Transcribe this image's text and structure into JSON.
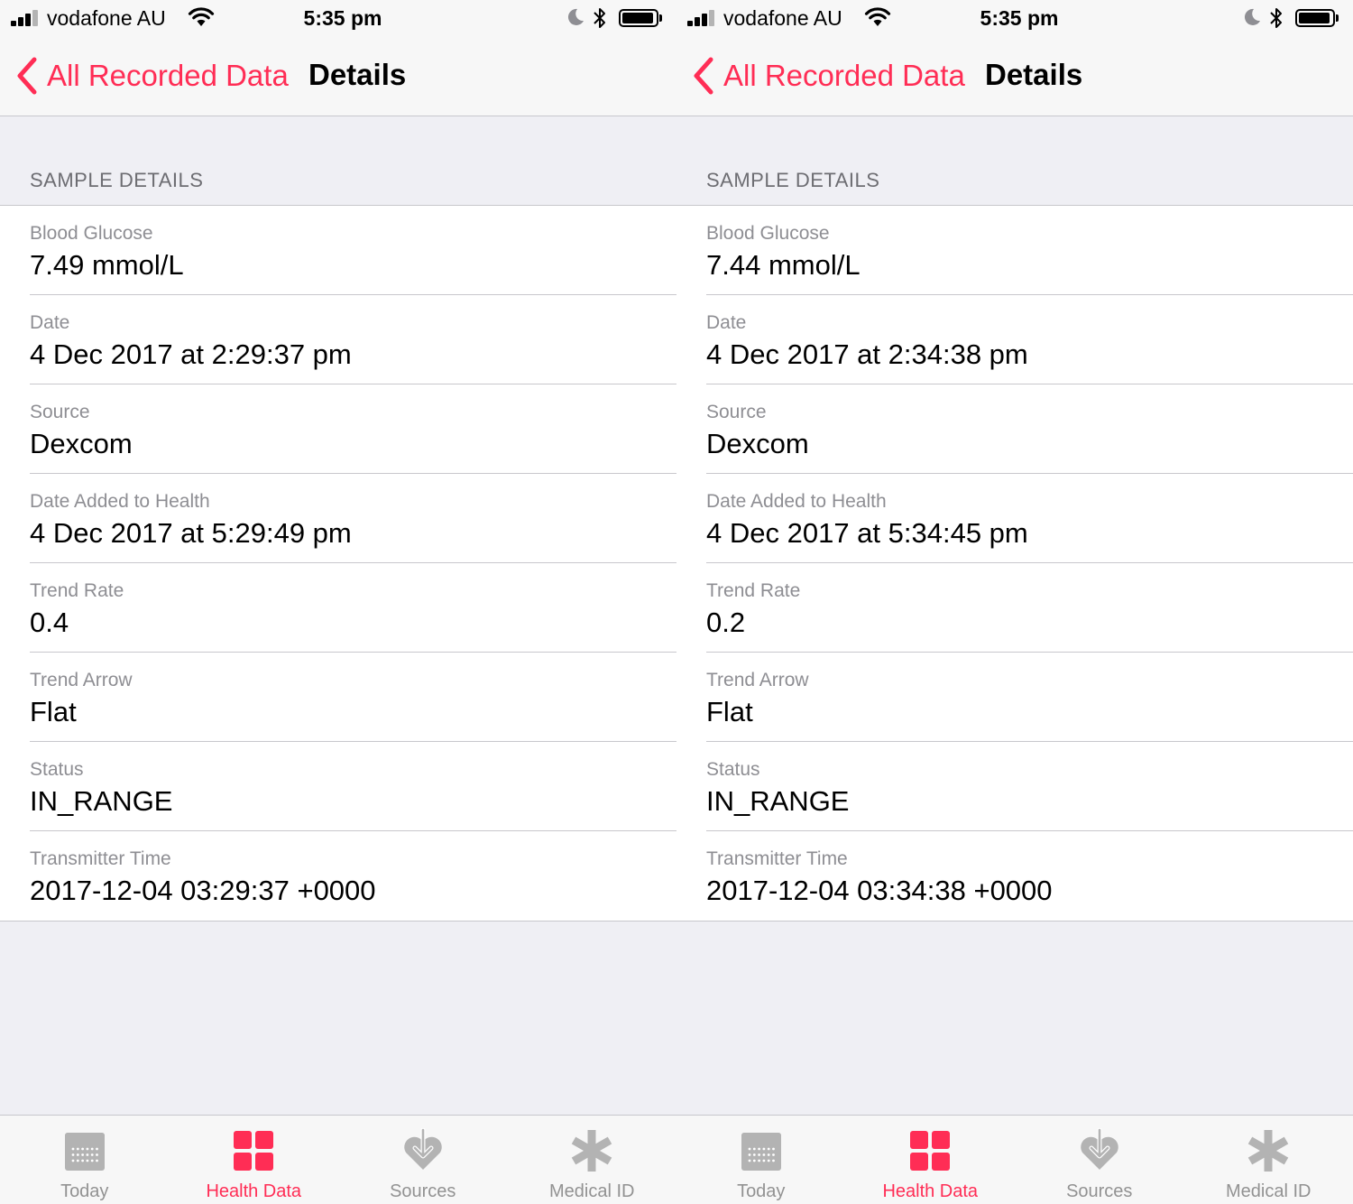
{
  "colors": {
    "accent": "#ff2d55",
    "inactive": "#929292",
    "background": "#efeff4",
    "label_gray": "#8e8e93"
  },
  "screens": [
    {
      "status_bar": {
        "carrier": "vodafone AU",
        "time": "5:35 pm"
      },
      "nav": {
        "back_label": "All Recorded Data",
        "title": "Details"
      },
      "section_header": "SAMPLE DETAILS",
      "rows": [
        {
          "label": "Blood Glucose",
          "value": "7.49 mmol/L"
        },
        {
          "label": "Date",
          "value": "4 Dec 2017 at 2:29:37 pm"
        },
        {
          "label": "Source",
          "value": "Dexcom"
        },
        {
          "label": "Date Added to Health",
          "value": "4 Dec 2017 at 5:29:49 pm"
        },
        {
          "label": "Trend Rate",
          "value": "0.4"
        },
        {
          "label": "Trend Arrow",
          "value": "Flat"
        },
        {
          "label": "Status",
          "value": "IN_RANGE"
        },
        {
          "label": "Transmitter Time",
          "value": "2017-12-04 03:29:37 +0000"
        }
      ],
      "tabs": [
        {
          "label": "Today",
          "icon": "calendar-icon",
          "active": false
        },
        {
          "label": "Health Data",
          "icon": "grid-icon",
          "active": true
        },
        {
          "label": "Sources",
          "icon": "heart-arrow-icon",
          "active": false
        },
        {
          "label": "Medical ID",
          "icon": "asterisk-icon",
          "active": false
        }
      ]
    },
    {
      "status_bar": {
        "carrier": "vodafone AU",
        "time": "5:35 pm"
      },
      "nav": {
        "back_label": "All Recorded Data",
        "title": "Details"
      },
      "section_header": "SAMPLE DETAILS",
      "rows": [
        {
          "label": "Blood Glucose",
          "value": "7.44 mmol/L"
        },
        {
          "label": "Date",
          "value": "4 Dec 2017 at 2:34:38 pm"
        },
        {
          "label": "Source",
          "value": "Dexcom"
        },
        {
          "label": "Date Added to Health",
          "value": "4 Dec 2017 at 5:34:45 pm"
        },
        {
          "label": "Trend Rate",
          "value": "0.2"
        },
        {
          "label": "Trend Arrow",
          "value": "Flat"
        },
        {
          "label": "Status",
          "value": "IN_RANGE"
        },
        {
          "label": "Transmitter Time",
          "value": "2017-12-04 03:34:38 +0000"
        }
      ],
      "tabs": [
        {
          "label": "Today",
          "icon": "calendar-icon",
          "active": false
        },
        {
          "label": "Health Data",
          "icon": "grid-icon",
          "active": true
        },
        {
          "label": "Sources",
          "icon": "heart-arrow-icon",
          "active": false
        },
        {
          "label": "Medical ID",
          "icon": "asterisk-icon",
          "active": false
        }
      ]
    }
  ]
}
